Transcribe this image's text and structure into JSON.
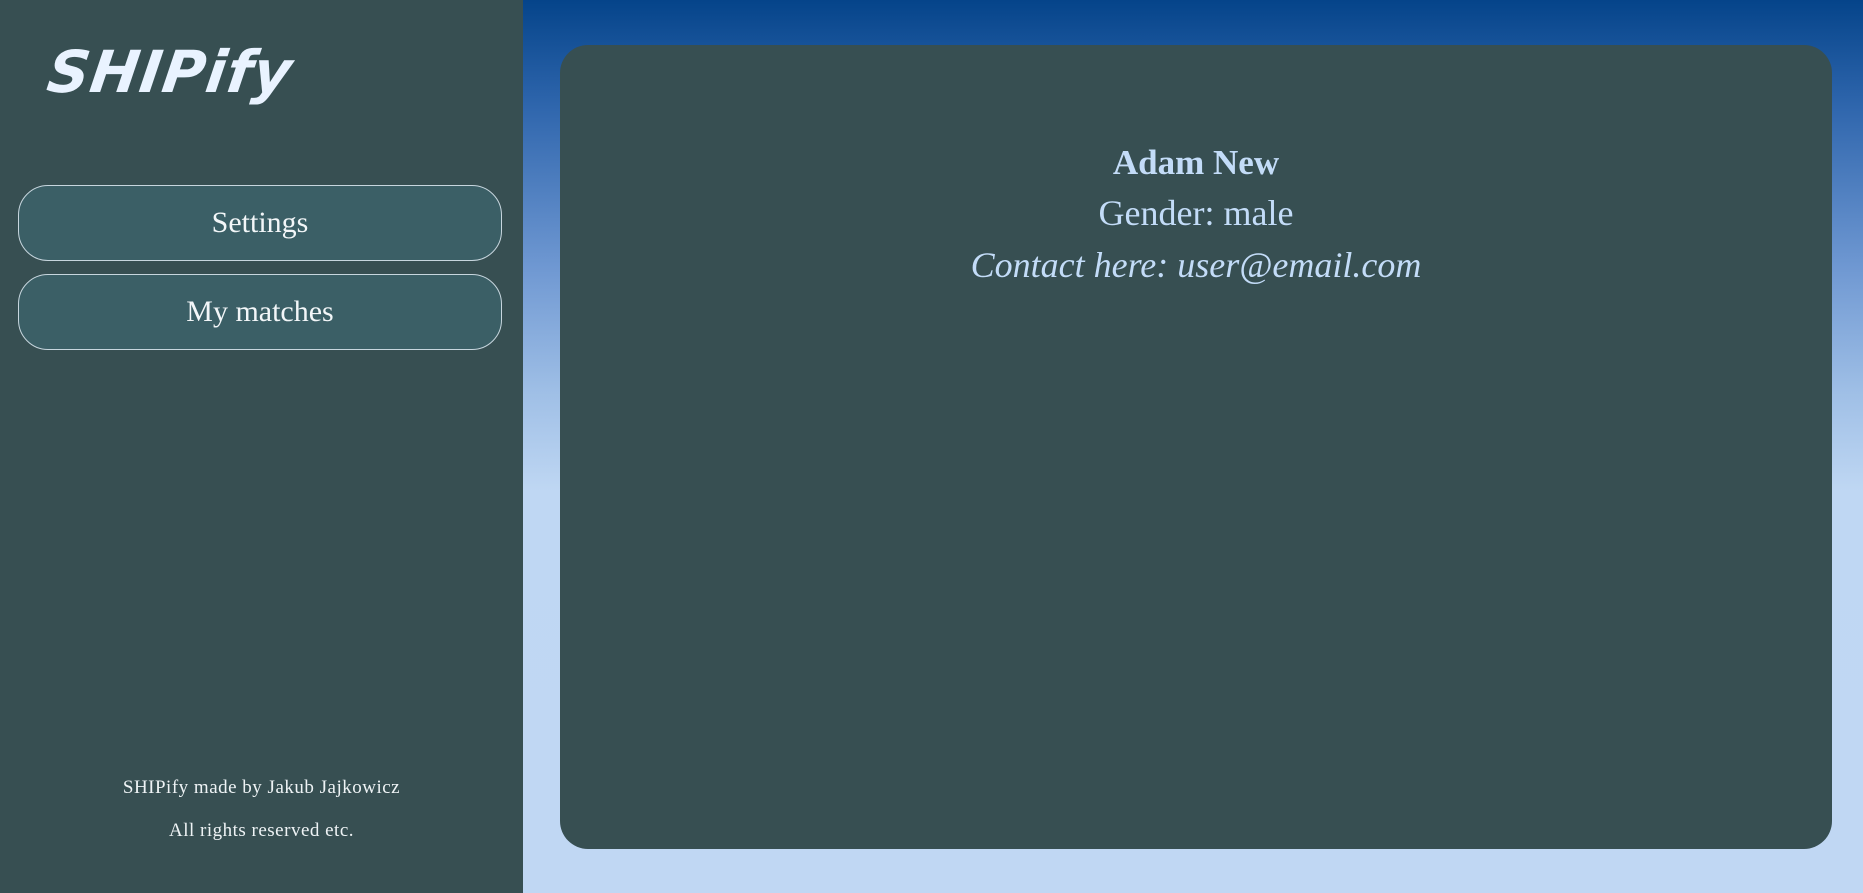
{
  "app": {
    "logo_text": "SHIPify"
  },
  "sidebar": {
    "items": [
      {
        "label": "Settings"
      },
      {
        "label": "My matches"
      }
    ],
    "footer": {
      "line1": "SHIPify made by Jakub Jajkowicz",
      "line2": "All rights reserved etc."
    }
  },
  "profile": {
    "name": "Adam New",
    "gender_line": "Gender: male",
    "contact_line": "Contact here: user@email.com"
  },
  "colors": {
    "panel_background": "#374f52",
    "nav_button_background": "#3b5f66",
    "text_accent": "#c3dcf8",
    "gradient_top": "#05448a",
    "gradient_bottom": "#c0d7f3"
  }
}
